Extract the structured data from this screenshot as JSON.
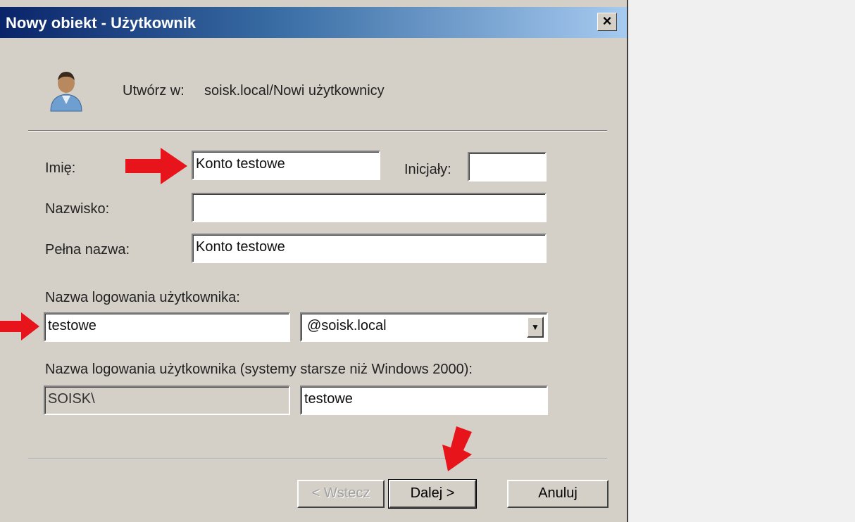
{
  "window": {
    "title": "Nowy obiekt - Użytkownik",
    "close_glyph": "×"
  },
  "header": {
    "create_in_label": "Utwórz w:",
    "create_in_path": "soisk.local/Nowi użytkownicy",
    "icon": "user-icon"
  },
  "form": {
    "first_name_label": "Imię:",
    "first_name_value": "Konto testowe",
    "initials_label": "Inicjały:",
    "initials_value": "",
    "last_name_label": "Nazwisko:",
    "last_name_value": "",
    "full_name_label": "Pełna nazwa:",
    "full_name_value": "Konto testowe",
    "logon_label": "Nazwa logowania użytkownika:",
    "logon_value": "testowe",
    "domain_value": "@soisk.local",
    "legacy_label": "Nazwa logowania użytkownika (systemy starsze niż Windows 2000):",
    "legacy_domain_value": "SOISK\\",
    "legacy_logon_value": "testowe"
  },
  "buttons": {
    "back_label": "< Wstecz",
    "next_label": "Dalej >",
    "cancel_label": "Anuluj"
  },
  "colors": {
    "title_bar": "#0a246a",
    "dialog_bg": "#d4d0c8",
    "arrow": "#e8141b"
  }
}
